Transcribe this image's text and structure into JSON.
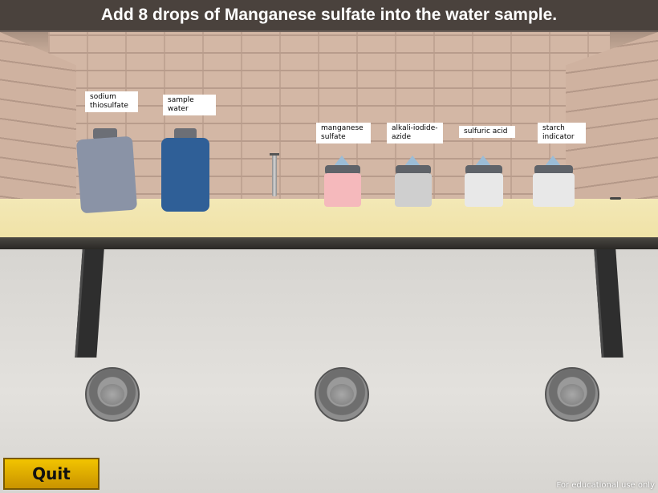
{
  "instruction": "Add 8 drops of Manganese sulfate into the water sample.",
  "labels": {
    "sodium_thiosulfate": [
      "sodium",
      "thiosulfate"
    ],
    "sample_water": "sample water",
    "manganese_sulfate": [
      "manganese",
      "sulfate"
    ],
    "alkali_iodide_azide": [
      "alkali-iodide-",
      "azide"
    ],
    "sulfuric_acid": "sulfuric acid",
    "starch_indicator": [
      "starch",
      "indicator"
    ]
  },
  "quit_label": "Quit",
  "footer": "For educational use only",
  "colors": {
    "banner_bg": "#4a423d",
    "quit_bg": "#e4b400",
    "sodium_thiosulfate_bottle": "#8a93a6",
    "sample_water_bottle": "#2f5f97",
    "manganese_sulfate_bottle": "#f5b9bc",
    "alkali_bottle": "#cfcfcf",
    "sulfuric_bottle": "#e8e8e8",
    "starch_bottle": "#e8e8e8"
  }
}
